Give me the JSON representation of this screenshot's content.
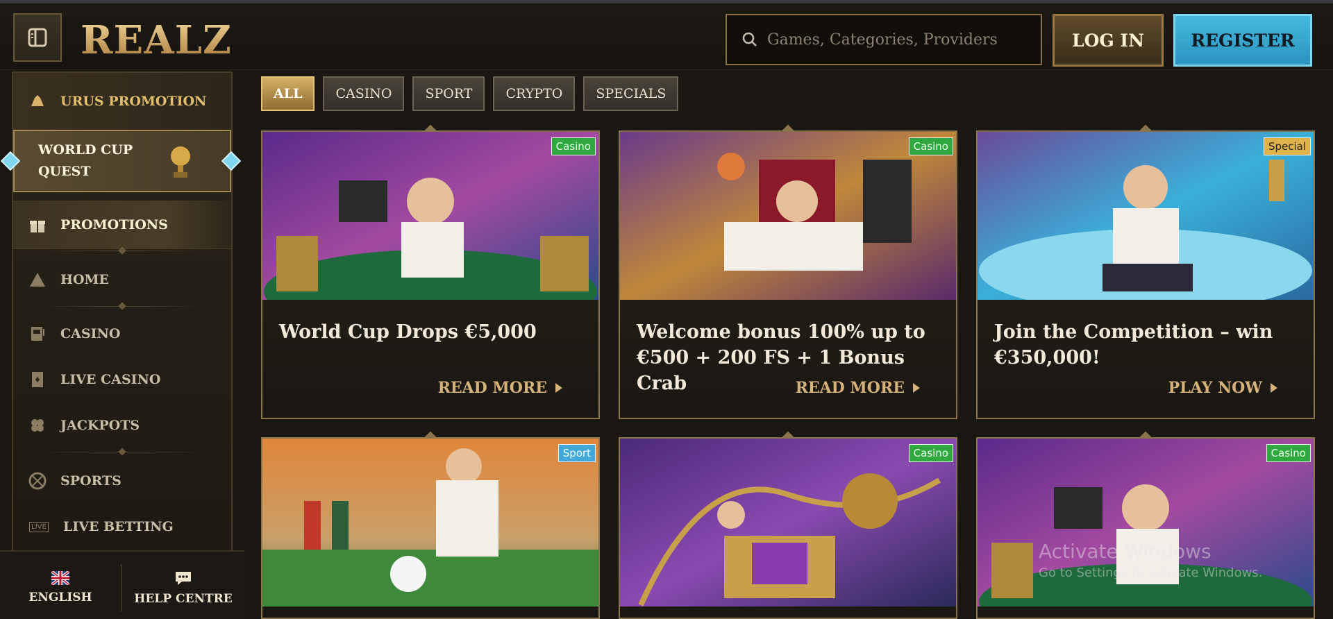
{
  "header": {
    "logo": "REALZ",
    "search_placeholder": "Games, Categories, Providers",
    "login_label": "LOG IN",
    "register_label": "REGISTER"
  },
  "sidebar": {
    "urus_promotion": "URUS PROMOTION",
    "world_cup_quest_line1": "WORLD CUP",
    "world_cup_quest_line2": "QUEST",
    "promotions": "PROMOTIONS",
    "items": [
      {
        "label": "HOME",
        "icon": "pyramid-icon"
      },
      {
        "label": "CASINO",
        "icon": "slot-machine-icon"
      },
      {
        "label": "LIVE CASINO",
        "icon": "card-icon"
      },
      {
        "label": "JACKPOTS",
        "icon": "clover-icon"
      },
      {
        "label": "SPORTS",
        "icon": "ball-icon"
      },
      {
        "label": "LIVE BETTING",
        "icon": "live-icon"
      }
    ],
    "live_badge": "LIVE",
    "language": "ENGLISH",
    "help_centre": "HELP CENTRE"
  },
  "filters": [
    "ALL",
    "CASINO",
    "SPORT",
    "CRYPTO",
    "SPECIALS"
  ],
  "cards": [
    {
      "badge": "Casino",
      "title": "World Cup Drops €5,000",
      "cta": "READ MORE"
    },
    {
      "badge": "Casino",
      "title": "Welcome bonus 100% up to €500 + 200 FS + 1 Bonus Crab",
      "cta": "READ MORE"
    },
    {
      "badge": "Special",
      "title": "Join the Competition – win €350,000!",
      "cta": "PLAY NOW"
    },
    {
      "badge": "Sport"
    },
    {
      "badge": "Casino"
    },
    {
      "badge": "Casino"
    }
  ],
  "watermark": {
    "line1": "Activate Windows",
    "line2": "Go to Settings to activate Windows."
  },
  "colors": {
    "accent_gold": "#d4b27a",
    "register_blue": "#45b9dd",
    "badge_casino": "#2fa83f",
    "badge_special": "#e0b24c",
    "badge_sport": "#42a8d8"
  }
}
